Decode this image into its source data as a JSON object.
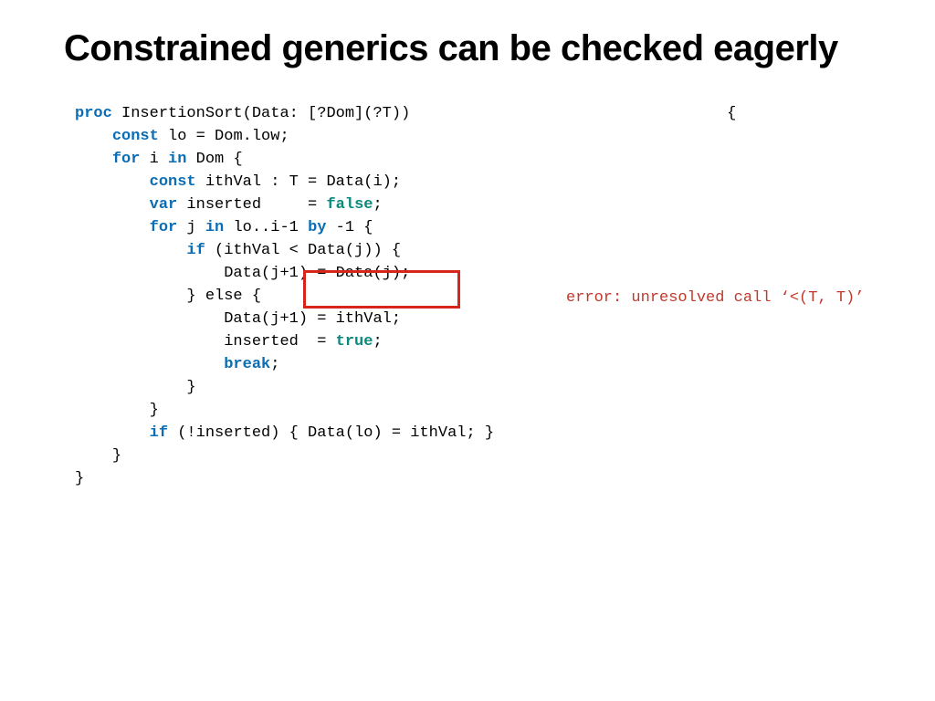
{
  "title": "Constrained generics can be checked eagerly",
  "code": {
    "l1a": "proc",
    "l1b": " InsertionSort(Data: [?Dom](?T))",
    "l1c": "{",
    "l2a": "const",
    "l2b": " lo = Dom.low;",
    "l3a": "for",
    "l3b": " i ",
    "l3c": "in",
    "l3d": " Dom {",
    "l4a": "const",
    "l4b": " ithVal : T = Data(i);",
    "l5a": "var",
    "l5b": " inserted     = ",
    "l5c": "false",
    "l5d": ";",
    "l6a": "for",
    "l6b": " j ",
    "l6c": "in",
    "l6d": " lo..i-1 ",
    "l6e": "by",
    "l6f": " -1 {",
    "l7a": "if",
    "l7b": " (ithVal < Data(j)) {",
    "l8": "Data(j+1) = Data(j);",
    "l9": "} else {",
    "l10": "Data(j+1) = ithVal;",
    "l11a": "inserted  = ",
    "l11b": "true",
    "l11c": ";",
    "l12": "break",
    "l12b": ";",
    "l13": "}",
    "l14": "}",
    "l15a": "if",
    "l15b": " (!inserted) { Data(lo) = ithVal; }",
    "l16": "}",
    "l17": "}"
  },
  "error": "error: unresolved call ‘<(T, T)’"
}
